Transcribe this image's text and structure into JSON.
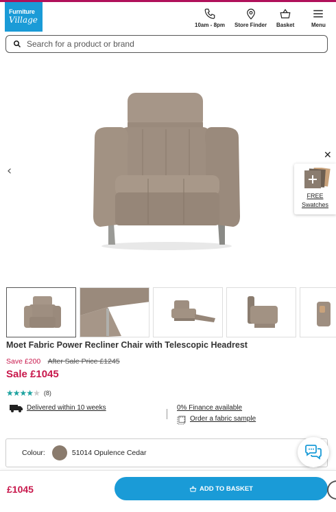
{
  "brand": {
    "line1": "Furniture",
    "line2": "Village"
  },
  "header_nav": [
    {
      "label": "10am - 8pm",
      "icon": "phone-icon"
    },
    {
      "label": "Store Finder",
      "icon": "location-pin-icon"
    },
    {
      "label": "Basket",
      "icon": "basket-icon"
    },
    {
      "label": "Menu",
      "icon": "hamburger-menu-icon"
    }
  ],
  "search": {
    "placeholder": "Search for a product or brand"
  },
  "gallery": {
    "prev": "‹",
    "next": "›",
    "close": "✕",
    "swatches_line1": "FREE",
    "swatches_line2": "Swatches"
  },
  "product": {
    "title": "Moet Fabric Power Recliner Chair with Telescopic Headrest",
    "save_text": "Save £200",
    "was_text": "After Sale Price £1245",
    "price": "Sale £1045",
    "rating": 4,
    "rating_max": 5,
    "review_count": "(8)"
  },
  "info": {
    "delivery": "Delivered within 10 weeks",
    "finance": "0% Finance available",
    "fabric_sample": "Order a fabric sample"
  },
  "colour": {
    "label": "Colour:",
    "value": "51014 Opulence Cedar",
    "swatch_color": "#8a7b6d"
  },
  "bottom_bar": {
    "price": "£1045",
    "add_label": "ADD TO BASKET"
  },
  "colors": {
    "brand_blue": "#1a9bd7",
    "sale_red": "#c8174b",
    "star_teal": "#1fa3a0"
  }
}
